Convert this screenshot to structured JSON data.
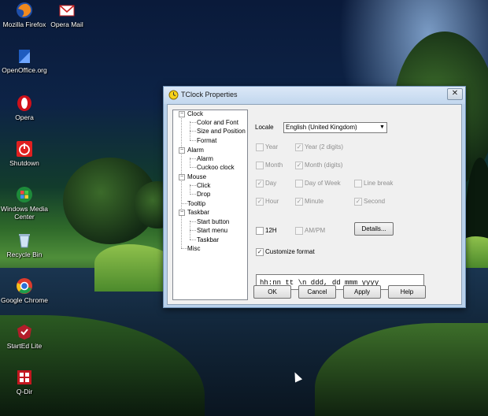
{
  "desktop": {
    "icons": [
      {
        "label": "Mozilla Firefox",
        "icon": "firefox-icon"
      },
      {
        "label": "Opera Mail",
        "icon": "mail-icon"
      },
      {
        "label": "OpenOffice.org",
        "icon": "openoffice-icon"
      },
      {
        "label": "Opera",
        "icon": "opera-icon"
      },
      {
        "label": "Shutdown",
        "icon": "power-icon"
      },
      {
        "label": "Windows Media Center",
        "icon": "media-center-icon"
      },
      {
        "label": "Recycle Bin",
        "icon": "recycle-bin-icon"
      },
      {
        "label": "Google Chrome",
        "icon": "chrome-icon"
      },
      {
        "label": "StartEd Lite",
        "icon": "started-icon"
      },
      {
        "label": "Q-Dir",
        "icon": "qdir-icon"
      }
    ]
  },
  "window": {
    "title": "TClock Properties",
    "close_glyph": "✕"
  },
  "tree": {
    "nodes": [
      {
        "label": "Clock",
        "expanded": true,
        "children": [
          "Color and Font",
          "Size and Position",
          "Format"
        ]
      },
      {
        "label": "Alarm",
        "expanded": true,
        "children": [
          "Alarm",
          "Cuckoo clock"
        ]
      },
      {
        "label": "Mouse",
        "expanded": true,
        "children": [
          "Click",
          "Drop"
        ]
      },
      {
        "label": "Tooltip",
        "expanded": null,
        "children": []
      },
      {
        "label": "Taskbar",
        "expanded": true,
        "children": [
          "Start button",
          "Start menu",
          "Taskbar"
        ]
      },
      {
        "label": "Misc",
        "expanded": null,
        "children": []
      }
    ],
    "expand_glyph": "−"
  },
  "format_panel": {
    "locale_label": "Locale",
    "locale_value": "English (United Kingdom)",
    "checkboxes": {
      "year": {
        "label": "Year",
        "checked": false,
        "enabled": false
      },
      "year2": {
        "label": "Year (2 digits)",
        "checked": true,
        "enabled": false
      },
      "month": {
        "label": "Month",
        "checked": false,
        "enabled": false
      },
      "month_digits": {
        "label": "Month (digits)",
        "checked": true,
        "enabled": false
      },
      "day": {
        "label": "Day",
        "checked": true,
        "enabled": false
      },
      "day_of_week": {
        "label": "Day of Week",
        "checked": false,
        "enabled": false
      },
      "line_break": {
        "label": "Line break",
        "checked": false,
        "enabled": false
      },
      "hour": {
        "label": "Hour",
        "checked": true,
        "enabled": false
      },
      "minute": {
        "label": "Minute",
        "checked": true,
        "enabled": false
      },
      "second": {
        "label": "Second",
        "checked": true,
        "enabled": false
      },
      "h12": {
        "label": "12H",
        "checked": false,
        "enabled": true
      },
      "ampm": {
        "label": "AM/PM",
        "checked": false,
        "enabled": false
      },
      "customize": {
        "label": "Customize format",
        "checked": true,
        "enabled": true
      }
    },
    "details_button": "Details...",
    "format_value": "hh:nn tt \\n ddd, dd mmm yyyy",
    "check_glyph": "✓"
  },
  "buttons": {
    "ok": "OK",
    "cancel": "Cancel",
    "apply": "Apply",
    "help": "Help"
  }
}
